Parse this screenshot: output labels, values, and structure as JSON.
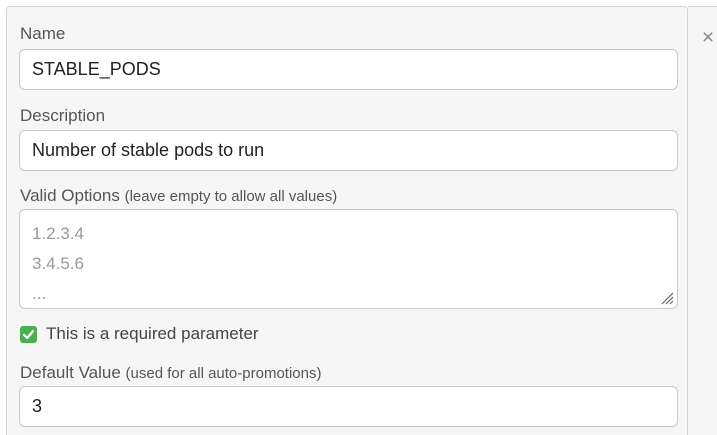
{
  "form": {
    "close_label": "×",
    "name": {
      "label": "Name",
      "value": "STABLE_PODS"
    },
    "description": {
      "label": "Description",
      "value": "Number of stable pods to run"
    },
    "valid_options": {
      "label": "Valid Options",
      "hint": "(leave empty to allow all values)",
      "placeholder": "1.2.3.4\n3.4.5.6\n..."
    },
    "required": {
      "checked": true,
      "label": "This is a required parameter"
    },
    "default_value": {
      "label": "Default Value",
      "hint": "(used for all auto-promotions)",
      "value": "3"
    }
  },
  "colors": {
    "panel_bg": "#f6f6f6",
    "border": "#c8c8c8",
    "checkbox_green": "#4caf50",
    "label_text": "#555555"
  },
  "icons": [
    "close-icon",
    "checkmark-icon",
    "resize-grip-icon"
  ]
}
